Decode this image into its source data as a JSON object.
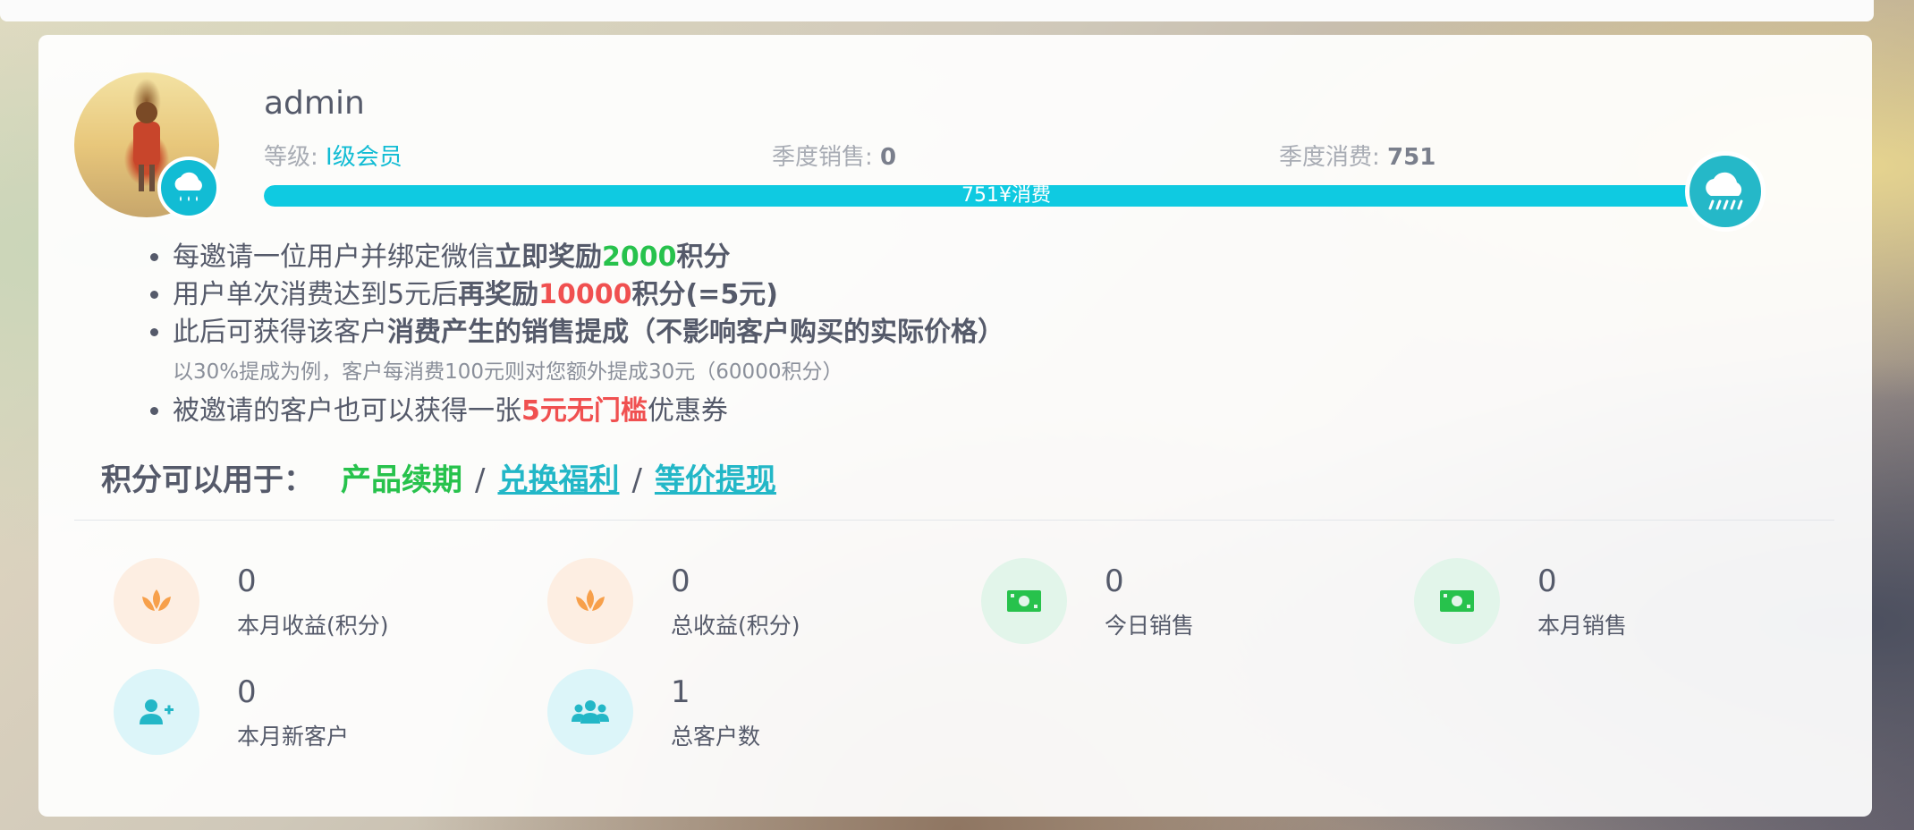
{
  "profile": {
    "username": "admin",
    "level_label": "等级:",
    "level_value": "Ⅰ级会员",
    "season_sales_label": "季度销售:",
    "season_sales_value": "0",
    "season_spend_label": "季度消费:",
    "season_spend_value": "751",
    "progress_text": "751¥消费",
    "progress_fraction": 0.97
  },
  "rules": {
    "r1_a": "每邀请一位用户并绑定微信",
    "r1_b": "立即奖励",
    "r1_c": "2000",
    "r1_d": "积分",
    "r2_a": "用户单次消费达到5元后",
    "r2_b": "再奖励",
    "r2_c": "10000",
    "r2_d": "积分(=5元)",
    "r3_a": "此后可获得该客户",
    "r3_b": "消费产生的销售提成（不影响客户购买的实际价格）",
    "r3_sub": "以30%提成为例，客户每消费100元则对您额外提成30元（60000积分）",
    "r4_a": "被邀请的客户也可以获得一张",
    "r4_b": "5元无门槛",
    "r4_c": "优惠券"
  },
  "uses": {
    "label": "积分可以用于：",
    "item1": "产品续期",
    "sep": "/",
    "item2": "兑换福利",
    "item3": "等价提现"
  },
  "stats": [
    {
      "value": "0",
      "label": "本月收益(积分)",
      "icon": "lotus-icon"
    },
    {
      "value": "0",
      "label": "总收益(积分)",
      "icon": "lotus-icon"
    },
    {
      "value": "0",
      "label": "今日销售",
      "icon": "money-bill-icon"
    },
    {
      "value": "0",
      "label": "本月销售",
      "icon": "money-bill-icon"
    },
    {
      "value": "0",
      "label": "本月新客户",
      "icon": "user-plus-icon"
    },
    {
      "value": "1",
      "label": "总客户数",
      "icon": "users-icon"
    }
  ],
  "colors": {
    "accent": "#12bcd4",
    "green": "#27c24c",
    "red": "#f05050",
    "orange_icon": "#f7a04b",
    "green_icon": "#27c24c",
    "cyan_icon": "#23b7c7"
  }
}
